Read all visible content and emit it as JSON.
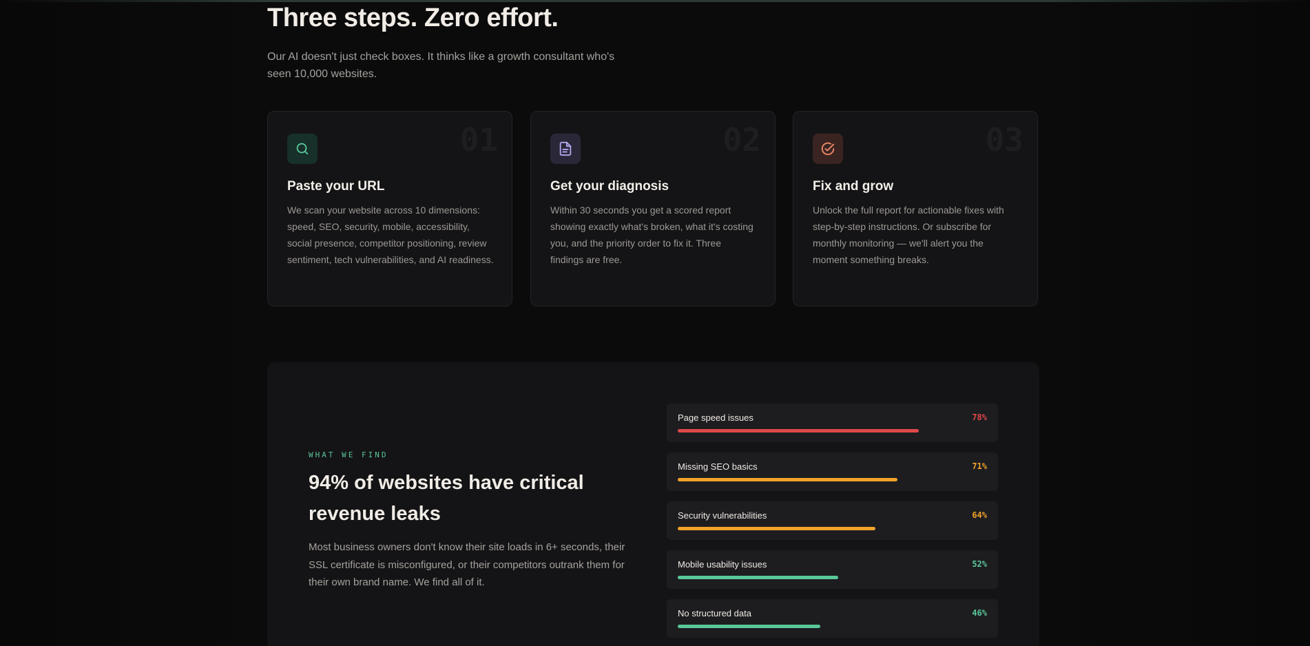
{
  "steps": {
    "title": "Three steps. Zero effort.",
    "subtitle": "Our AI doesn't just check boxes. It thinks like a growth consultant who's seen 10,000 websites.",
    "cards": [
      {
        "number": "01",
        "icon": "search-icon",
        "title": "Paste your URL",
        "text": "We scan your website across 10 dimensions: speed, SEO, security, mobile, accessibility, social presence, competitor positioning, review sentiment, tech vulnerabilities, and AI readiness."
      },
      {
        "number": "02",
        "icon": "document-icon",
        "title": "Get your diagnosis",
        "text": "Within 30 seconds you get a scored report showing exactly what's broken, what it's costing you, and the priority order to fix it. Three findings are free."
      },
      {
        "number": "03",
        "icon": "check-circle-icon",
        "title": "Fix and grow",
        "text": "Unlock the full report for actionable fixes with step-by-step instructions. Or subscribe for monthly monitoring — we'll alert you the moment something breaks."
      }
    ]
  },
  "findings": {
    "eyebrow": "WHAT WE FIND",
    "title": "94% of websites have critical revenue leaks",
    "text": "Most business owners don't know their site loads in 6+ seconds, their SSL certificate is misconfigured, or their competitors outrank them for their own brand name. We find all of it.",
    "metrics": [
      {
        "label": "Page speed issues",
        "percent_label": "78%",
        "value": 0.78,
        "color": "#e04848"
      },
      {
        "label": "Missing SEO basics",
        "percent_label": "71%",
        "value": 0.71,
        "color": "#f2a32a"
      },
      {
        "label": "Security vulnerabilities",
        "percent_label": "64%",
        "value": 0.64,
        "color": "#f2a32a"
      },
      {
        "label": "Mobile usability issues",
        "percent_label": "52%",
        "value": 0.52,
        "color": "#59c99a"
      },
      {
        "label": "No structured data",
        "percent_label": "46%",
        "value": 0.46,
        "color": "#59c99a"
      }
    ]
  },
  "colors": {
    "accent_green": "#59c99a",
    "accent_purple": "#b4a8f0",
    "accent_orange": "#f08a6a"
  }
}
